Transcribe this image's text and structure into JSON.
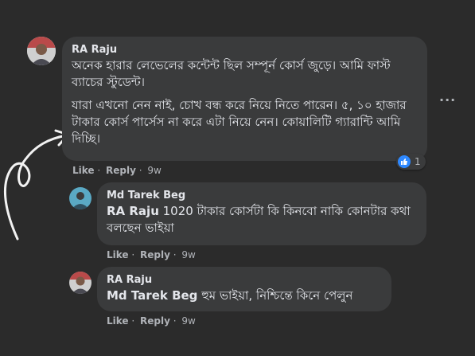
{
  "comments": [
    {
      "author": "RA Raju",
      "paragraphs": [
        "অনেক হারার লেভেলের কন্টেন্ট ছিল সম্পূর্ন কোর্স জুড়ে। আমি ফাস্ট ব্যাচের স্টুডেন্ট।",
        "যারা এখনো নেন নাই, চোখ বন্ধ করে নিয়ে নিতে পারেন। ৫, ১০ হাজার টাকার কোর্স পার্সেস না করে এটা নিয়ে নেন। কোয়ালিটি গ্যারান্টি আমি দিচ্ছি।"
      ],
      "like_label": "Like",
      "reply_label": "Reply",
      "time": "9w",
      "reaction_count": "1"
    },
    {
      "author": "Md Tarek Beg",
      "mention": "RA Raju",
      "text": " 1020 টাকার কোর্সটা কি কিনবো নাকি কোনটার কথা বলছেন ভাইয়া",
      "like_label": "Like",
      "reply_label": "Reply",
      "time": "9w"
    },
    {
      "author": "RA Raju",
      "mention": "Md Tarek Beg",
      "text": " হুম ভাইয়া, নিশ্চিন্তে কিনে পেলুন",
      "like_label": "Like",
      "reply_label": "Reply",
      "time": "9w"
    }
  ],
  "more_options": "···",
  "colors": {
    "background": "#2b2b2b",
    "bubble": "#3a3b3c",
    "like_blue": "#2d88ff"
  },
  "icons": [
    "like-icon",
    "more-options-icon",
    "curved-arrow-icon"
  ]
}
